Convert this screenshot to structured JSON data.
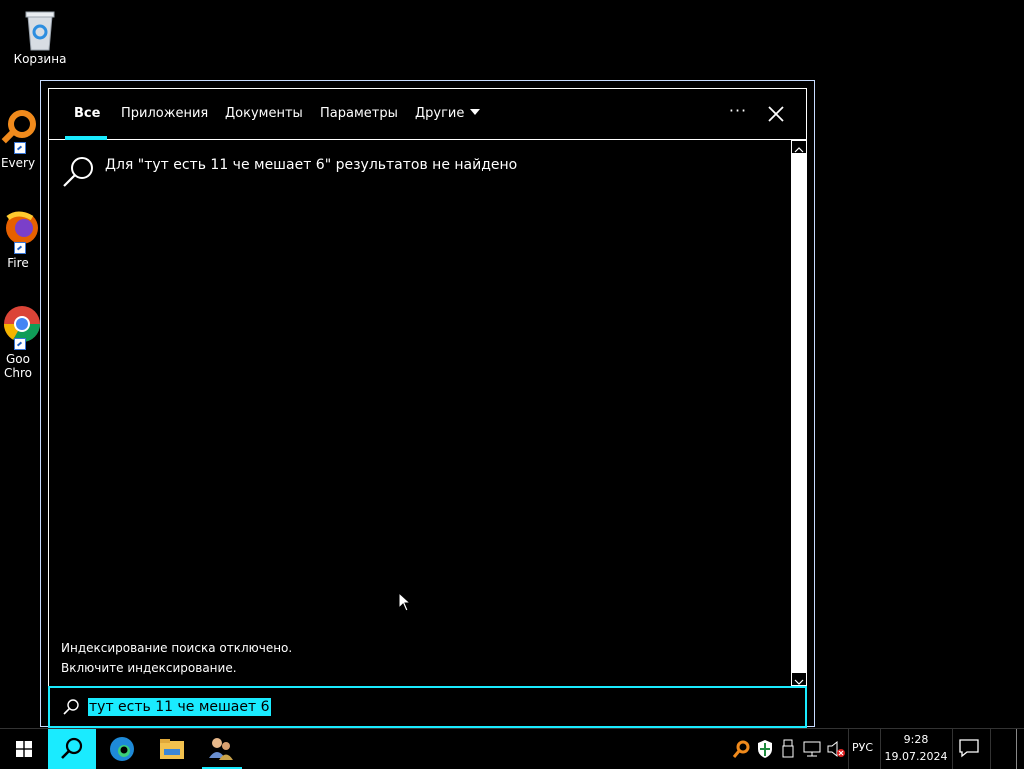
{
  "desktop": {
    "icons": [
      {
        "label": "Корзина"
      },
      {
        "label": "Every"
      },
      {
        "label": "Fire"
      },
      {
        "label_line1": "Goo",
        "label_line2": "Chro"
      }
    ]
  },
  "search_panel": {
    "tabs": [
      {
        "label": "Все",
        "active": true
      },
      {
        "label": "Приложения",
        "active": false
      },
      {
        "label": "Документы",
        "active": false
      },
      {
        "label": "Параметры",
        "active": false
      },
      {
        "label": "Другие",
        "active": false
      }
    ],
    "more_label": "···",
    "no_results_text": "Для \"тут есть 11 че мешает 6\" результатов не найдено",
    "indexing_line1": "Индексирование поиска отключено.",
    "indexing_line2": "Включите индексирование.",
    "search_value": "тут есть 11 че мешает 6"
  },
  "taskbar": {
    "language": "РУС",
    "time": "9:28",
    "date": "19.07.2024"
  },
  "colors": {
    "accent": "#1aebff",
    "background": "#000000",
    "text": "#ffffff"
  },
  "icons": [
    "recycle-bin-icon",
    "everything-icon",
    "firefox-icon",
    "chrome-icon",
    "search-icon",
    "close-icon",
    "windows-start-icon",
    "edge-icon",
    "file-explorer-icon",
    "users-icon",
    "defender-icon",
    "usb-icon",
    "network-icon",
    "volume-muted-icon",
    "notification-icon"
  ]
}
